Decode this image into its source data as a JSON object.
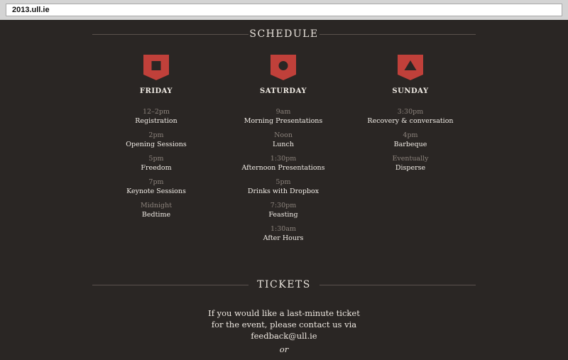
{
  "browser": {
    "url": "2013.ull.ie"
  },
  "schedule": {
    "heading": "SCHEDULE",
    "days": [
      {
        "name": "FRIDAY",
        "icon": "square-shield-icon",
        "events": [
          {
            "time": "12–2pm",
            "title": "Registration"
          },
          {
            "time": "2pm",
            "title": "Opening Sessions"
          },
          {
            "time": "5pm",
            "title": "Freedom"
          },
          {
            "time": "7pm",
            "title": "Keynote Sessions"
          },
          {
            "time": "Midnight",
            "title": "Bedtime"
          }
        ]
      },
      {
        "name": "SATURDAY",
        "icon": "circle-shield-icon",
        "events": [
          {
            "time": "9am",
            "title": "Morning Presentations"
          },
          {
            "time": "Noon",
            "title": "Lunch"
          },
          {
            "time": "1:30pm",
            "title": "Afternoon Presentations"
          },
          {
            "time": "5pm",
            "title": "Drinks with Dropbox"
          },
          {
            "time": "7:30pm",
            "title": "Feasting"
          },
          {
            "time": "1:30am",
            "title": "After Hours"
          }
        ]
      },
      {
        "name": "SUNDAY",
        "icon": "triangle-shield-icon",
        "events": [
          {
            "time": "3:30pm",
            "title": "Recovery & conversation"
          },
          {
            "time": "4pm",
            "title": "Barbeque"
          },
          {
            "time": "Eventually",
            "title": "Disperse"
          }
        ]
      }
    ]
  },
  "tickets": {
    "heading": "TICKETS",
    "lines": [
      "If you would like a last-minute ticket",
      "for the event, please contact us via",
      "feedback@ull.ie"
    ],
    "or": "or"
  },
  "colors": {
    "background": "#2a2624",
    "accent": "#c0403a",
    "text": "#f2ede7",
    "muted": "#8c837c"
  }
}
